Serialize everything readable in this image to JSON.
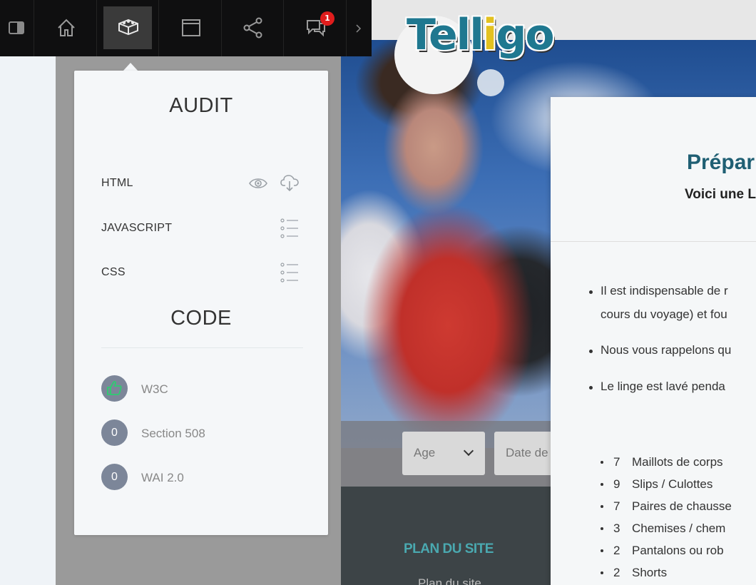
{
  "toolbar": {
    "items": [
      {
        "name": "panel-toggle",
        "icon": "sidebar-toggle-icon"
      },
      {
        "name": "home",
        "icon": "home-icon"
      },
      {
        "name": "audit",
        "icon": "box-icon",
        "active": true
      },
      {
        "name": "window",
        "icon": "window-icon"
      },
      {
        "name": "share",
        "icon": "share-icon"
      },
      {
        "name": "comments",
        "icon": "chat-icon",
        "badge": "1"
      },
      {
        "name": "more",
        "icon": "chevron-right-icon"
      }
    ],
    "badge_color": "#e01d1d"
  },
  "audit_panel": {
    "audit_title": "AUDIT",
    "rows": [
      {
        "label": "HTML",
        "icons": [
          "eye-icon",
          "cloud-download-icon"
        ]
      },
      {
        "label": "JAVASCRIPT",
        "icons": [
          "list-icon"
        ]
      },
      {
        "label": "CSS",
        "icons": [
          "list-icon"
        ]
      }
    ],
    "code_title": "CODE",
    "scores": [
      {
        "value": "",
        "icon": "thumbs-up-icon",
        "label": "W3C"
      },
      {
        "value": "0",
        "label": "Section 508"
      },
      {
        "value": "0",
        "label": "WAI 2.0"
      }
    ]
  },
  "website": {
    "logo": "Telligo",
    "filters": {
      "age_label": "Age",
      "date_label": "Date de"
    },
    "footer": {
      "title": "PLAN DU SITE",
      "link": "Plan du site"
    },
    "content": {
      "title": "Prépar",
      "subtitle": "Voici une L",
      "bullets": [
        "Il est indispensable de r",
        "cours du voyage) et fou",
        "Nous vous rappelons qu",
        "Le linge est lavé penda"
      ],
      "packing_list": [
        {
          "qty": "7",
          "item": "Maillots de corps"
        },
        {
          "qty": "9",
          "item": "Slips / Culottes"
        },
        {
          "qty": "7",
          "item": "Paires de chausse"
        },
        {
          "qty": "3",
          "item": "Chemises / chem"
        },
        {
          "qty": "2",
          "item": "Pantalons ou rob"
        },
        {
          "qty": "2",
          "item": "Shorts"
        }
      ]
    }
  },
  "colors": {
    "accent_green": "#2ecc71",
    "score_grey": "#7c8699",
    "title_teal": "#1f5f73"
  }
}
